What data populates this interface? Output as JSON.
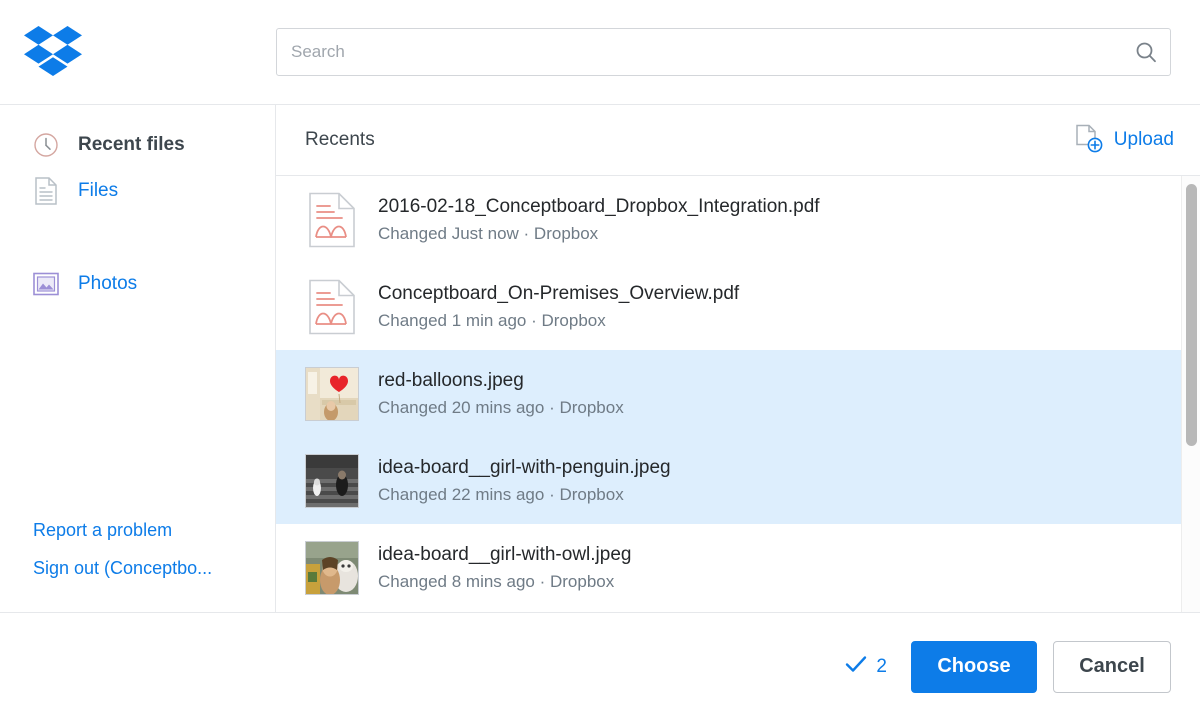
{
  "app": {
    "name": "Dropbox Chooser",
    "logo_icon": "dropbox-logo",
    "accent_color": "#0d7ce8",
    "selected_row_color": "#ddeefd"
  },
  "search": {
    "placeholder": "Search",
    "value": "",
    "icon": "search-icon"
  },
  "sidebar": {
    "items": [
      {
        "label": "Recent files",
        "icon": "clock-icon",
        "active": true
      },
      {
        "label": "Files",
        "icon": "document-icon",
        "active": false
      },
      {
        "label": "Photos",
        "icon": "photo-icon",
        "active": false
      }
    ],
    "footer_links": [
      {
        "label": "Report a problem"
      },
      {
        "label": "Sign out (Conceptbo..."
      }
    ]
  },
  "main": {
    "title": "Recents",
    "upload": {
      "label": "Upload",
      "icon": "upload-file-icon"
    },
    "files": [
      {
        "name": "2016-02-18_Conceptboard_Dropbox_Integration.pdf",
        "meta": "Changed Just now · Dropbox",
        "thumb_type": "pdf",
        "selected": false
      },
      {
        "name": "Conceptboard_On-Premises_Overview.pdf",
        "meta": "Changed 1 min ago · Dropbox",
        "thumb_type": "pdf",
        "selected": false
      },
      {
        "name": "red-balloons.jpeg",
        "meta": "Changed 20 mins ago · Dropbox",
        "thumb_type": "photo-balloons",
        "selected": true
      },
      {
        "name": "idea-board__girl-with-penguin.jpeg",
        "meta": "Changed 22 mins ago · Dropbox",
        "thumb_type": "photo-penguin",
        "selected": true
      },
      {
        "name": "idea-board__girl-with-owl.jpeg",
        "meta": "Changed 8 mins ago · Dropbox",
        "thumb_type": "photo-owl",
        "selected": false
      }
    ]
  },
  "footer": {
    "selected_count": "2",
    "check_icon": "checkmark-icon",
    "choose_label": "Choose",
    "cancel_label": "Cancel"
  }
}
